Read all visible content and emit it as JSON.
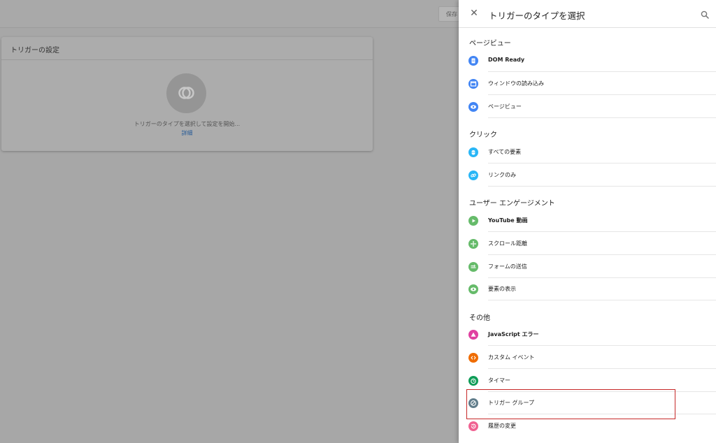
{
  "background": {
    "save_label": "保存",
    "card_title": "トリガーの設定",
    "hint": "トリガーのタイプを選択して設定を開始...",
    "link": "詳細"
  },
  "panel": {
    "title": "トリガーのタイプを選択",
    "close_icon": "close-icon",
    "search_icon": "search-icon",
    "sections": [
      {
        "title": "ページビュー",
        "items": [
          {
            "label": "DOM Ready",
            "icon": "document-icon",
            "color": "#4285f4"
          },
          {
            "label": "ウィンドウの読み込み",
            "icon": "window-icon",
            "color": "#4285f4"
          },
          {
            "label": "ページビュー",
            "icon": "eye-icon",
            "color": "#4285f4"
          }
        ]
      },
      {
        "title": "クリック",
        "items": [
          {
            "label": "すべての要素",
            "icon": "cursor-click-icon",
            "color": "#29b6f6"
          },
          {
            "label": "リンクのみ",
            "icon": "link-icon",
            "color": "#29b6f6"
          }
        ]
      },
      {
        "title": "ユーザー エンゲージメント",
        "items": [
          {
            "label": "YouTube 動画",
            "icon": "play-icon",
            "color": "#66bb6a"
          },
          {
            "label": "スクロール距離",
            "icon": "move-icon",
            "color": "#66bb6a"
          },
          {
            "label": "フォームの送信",
            "icon": "form-icon",
            "color": "#66bb6a"
          },
          {
            "label": "要素の表示",
            "icon": "eye-icon",
            "color": "#66bb6a"
          }
        ]
      },
      {
        "title": "その他",
        "items": [
          {
            "label": "JavaScript エラー",
            "icon": "warning-icon",
            "color": "#e040a0"
          },
          {
            "label": "カスタム イベント",
            "icon": "code-icon",
            "color": "#ef6c00"
          },
          {
            "label": "タイマー",
            "icon": "timer-icon",
            "color": "#0f9d58"
          },
          {
            "label": "トリガー グループ",
            "icon": "trigger-group-icon",
            "color": "#607d8b"
          },
          {
            "label": "履歴の変更",
            "icon": "history-icon",
            "color": "#f06292"
          }
        ]
      }
    ]
  }
}
